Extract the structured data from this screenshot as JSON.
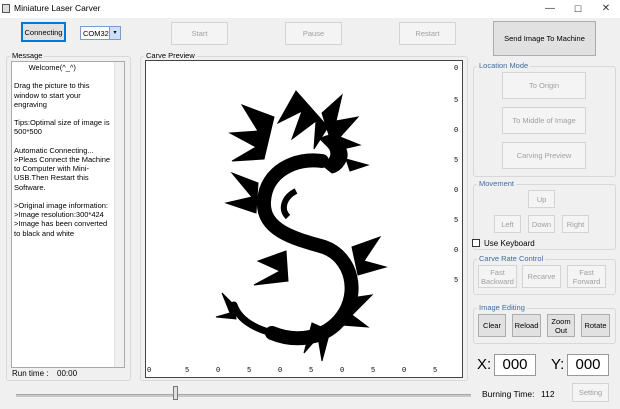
{
  "window": {
    "title": "Miniature Laser Carver",
    "min": "—",
    "max": "☐",
    "close": "✕"
  },
  "toolbar": {
    "connecting": "Connecting",
    "port": "COM32",
    "start": "Start",
    "pause": "Pause",
    "restart": "Restart",
    "send": "Send Image To Machine"
  },
  "message": {
    "label": "Message",
    "text": "       Welcome(^_^)\n\nDrag the picture to this window to start your engraving\n\nTips:Optimal size of image is 500*500\n\nAutomatic Connecting...\n>Pleas Connect the Machine to Computer with Mini-USB.Then Restart this Software.\n\n>Original image information:\n>Image resolution:300*424\n>Image has been converted to black and white",
    "run_time_label": "Run time :",
    "run_time_value": "00:00"
  },
  "carve_preview": {
    "label": "Carve Preview",
    "ruler_bottom": [
      "0",
      "5",
      "0",
      "5",
      "0",
      "5",
      "0",
      "5",
      "0",
      "5"
    ],
    "ruler_right": [
      "0",
      "5",
      "0",
      "5",
      "0",
      "5",
      "0",
      "5"
    ]
  },
  "location_mode": {
    "label": "Location Mode",
    "to_origin": "To Origin",
    "to_middle": "To Middle of Image",
    "carving_preview": "Carving Preview"
  },
  "movement": {
    "label": "Movement",
    "up": "Up",
    "left": "Left",
    "down": "Down",
    "right": "Right",
    "use_keyboard": "Use Keyboard"
  },
  "carve_rate": {
    "label": "Carve Rate Control",
    "fast_backward": "Fast Backward",
    "recarve": "Recarve",
    "fast_forward": "Fast Forward"
  },
  "image_editing": {
    "label": "Image Editing",
    "clear": "Clear",
    "reload": "Reload",
    "zoom_out": "Zoom Out",
    "rotate": "Rotate"
  },
  "coords": {
    "x_label": "X:",
    "x_value": "000",
    "y_label": "Y:",
    "y_value": "000"
  },
  "bottom": {
    "burning_time_label": "Burning Time:",
    "burning_time_value": "112",
    "setting": "Setting",
    "slider_level": 0.35
  }
}
